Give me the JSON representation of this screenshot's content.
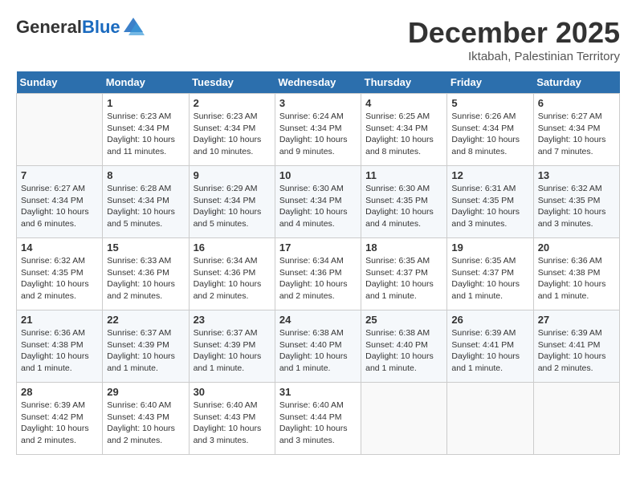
{
  "header": {
    "logo_general": "General",
    "logo_blue": "Blue",
    "month_title": "December 2025",
    "location": "Iktabah, Palestinian Territory"
  },
  "columns": [
    "Sunday",
    "Monday",
    "Tuesday",
    "Wednesday",
    "Thursday",
    "Friday",
    "Saturday"
  ],
  "weeks": [
    [
      {
        "day": "",
        "info": ""
      },
      {
        "day": "1",
        "info": "Sunrise: 6:23 AM\nSunset: 4:34 PM\nDaylight: 10 hours\nand 11 minutes."
      },
      {
        "day": "2",
        "info": "Sunrise: 6:23 AM\nSunset: 4:34 PM\nDaylight: 10 hours\nand 10 minutes."
      },
      {
        "day": "3",
        "info": "Sunrise: 6:24 AM\nSunset: 4:34 PM\nDaylight: 10 hours\nand 9 minutes."
      },
      {
        "day": "4",
        "info": "Sunrise: 6:25 AM\nSunset: 4:34 PM\nDaylight: 10 hours\nand 8 minutes."
      },
      {
        "day": "5",
        "info": "Sunrise: 6:26 AM\nSunset: 4:34 PM\nDaylight: 10 hours\nand 8 minutes."
      },
      {
        "day": "6",
        "info": "Sunrise: 6:27 AM\nSunset: 4:34 PM\nDaylight: 10 hours\nand 7 minutes."
      }
    ],
    [
      {
        "day": "7",
        "info": "Sunrise: 6:27 AM\nSunset: 4:34 PM\nDaylight: 10 hours\nand 6 minutes."
      },
      {
        "day": "8",
        "info": "Sunrise: 6:28 AM\nSunset: 4:34 PM\nDaylight: 10 hours\nand 5 minutes."
      },
      {
        "day": "9",
        "info": "Sunrise: 6:29 AM\nSunset: 4:34 PM\nDaylight: 10 hours\nand 5 minutes."
      },
      {
        "day": "10",
        "info": "Sunrise: 6:30 AM\nSunset: 4:34 PM\nDaylight: 10 hours\nand 4 minutes."
      },
      {
        "day": "11",
        "info": "Sunrise: 6:30 AM\nSunset: 4:35 PM\nDaylight: 10 hours\nand 4 minutes."
      },
      {
        "day": "12",
        "info": "Sunrise: 6:31 AM\nSunset: 4:35 PM\nDaylight: 10 hours\nand 3 minutes."
      },
      {
        "day": "13",
        "info": "Sunrise: 6:32 AM\nSunset: 4:35 PM\nDaylight: 10 hours\nand 3 minutes."
      }
    ],
    [
      {
        "day": "14",
        "info": "Sunrise: 6:32 AM\nSunset: 4:35 PM\nDaylight: 10 hours\nand 2 minutes."
      },
      {
        "day": "15",
        "info": "Sunrise: 6:33 AM\nSunset: 4:36 PM\nDaylight: 10 hours\nand 2 minutes."
      },
      {
        "day": "16",
        "info": "Sunrise: 6:34 AM\nSunset: 4:36 PM\nDaylight: 10 hours\nand 2 minutes."
      },
      {
        "day": "17",
        "info": "Sunrise: 6:34 AM\nSunset: 4:36 PM\nDaylight: 10 hours\nand 2 minutes."
      },
      {
        "day": "18",
        "info": "Sunrise: 6:35 AM\nSunset: 4:37 PM\nDaylight: 10 hours\nand 1 minute."
      },
      {
        "day": "19",
        "info": "Sunrise: 6:35 AM\nSunset: 4:37 PM\nDaylight: 10 hours\nand 1 minute."
      },
      {
        "day": "20",
        "info": "Sunrise: 6:36 AM\nSunset: 4:38 PM\nDaylight: 10 hours\nand 1 minute."
      }
    ],
    [
      {
        "day": "21",
        "info": "Sunrise: 6:36 AM\nSunset: 4:38 PM\nDaylight: 10 hours\nand 1 minute."
      },
      {
        "day": "22",
        "info": "Sunrise: 6:37 AM\nSunset: 4:39 PM\nDaylight: 10 hours\nand 1 minute."
      },
      {
        "day": "23",
        "info": "Sunrise: 6:37 AM\nSunset: 4:39 PM\nDaylight: 10 hours\nand 1 minute."
      },
      {
        "day": "24",
        "info": "Sunrise: 6:38 AM\nSunset: 4:40 PM\nDaylight: 10 hours\nand 1 minute."
      },
      {
        "day": "25",
        "info": "Sunrise: 6:38 AM\nSunset: 4:40 PM\nDaylight: 10 hours\nand 1 minute."
      },
      {
        "day": "26",
        "info": "Sunrise: 6:39 AM\nSunset: 4:41 PM\nDaylight: 10 hours\nand 1 minute."
      },
      {
        "day": "27",
        "info": "Sunrise: 6:39 AM\nSunset: 4:41 PM\nDaylight: 10 hours\nand 2 minutes."
      }
    ],
    [
      {
        "day": "28",
        "info": "Sunrise: 6:39 AM\nSunset: 4:42 PM\nDaylight: 10 hours\nand 2 minutes."
      },
      {
        "day": "29",
        "info": "Sunrise: 6:40 AM\nSunset: 4:43 PM\nDaylight: 10 hours\nand 2 minutes."
      },
      {
        "day": "30",
        "info": "Sunrise: 6:40 AM\nSunset: 4:43 PM\nDaylight: 10 hours\nand 3 minutes."
      },
      {
        "day": "31",
        "info": "Sunrise: 6:40 AM\nSunset: 4:44 PM\nDaylight: 10 hours\nand 3 minutes."
      },
      {
        "day": "",
        "info": ""
      },
      {
        "day": "",
        "info": ""
      },
      {
        "day": "",
        "info": ""
      }
    ]
  ]
}
